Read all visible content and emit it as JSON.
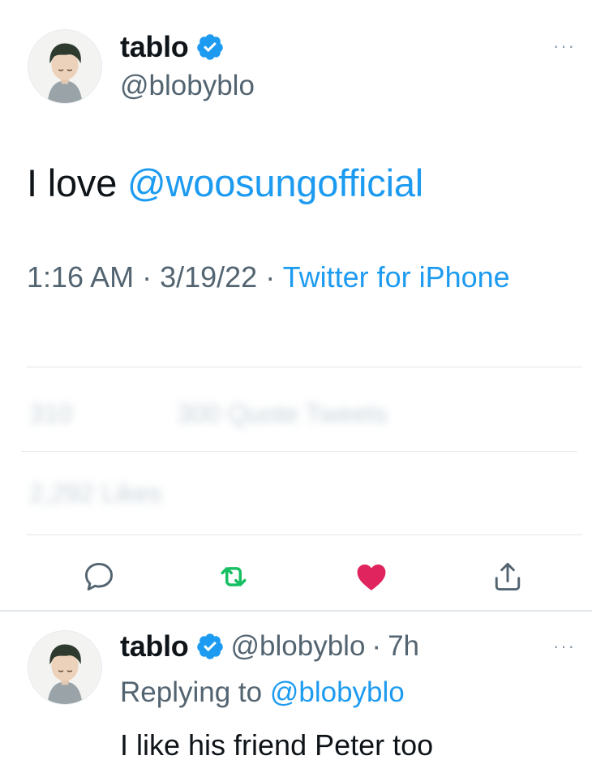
{
  "tweet": {
    "author_name": "tablo",
    "author_handle": "@blobyblo",
    "more_label": "···",
    "text_prefix": "I love ",
    "mention": "@woosungofficial",
    "time": "1:16 AM",
    "dot1": " · ",
    "date": "3/19/22",
    "dot2": " · ",
    "source": "Twitter for iPhone",
    "stats_row1": {
      "retweets": "310",
      "quotes": "300 Quote Tweets"
    },
    "stats_row2": {
      "likes": "2,292 Likes"
    }
  },
  "actions": {
    "reply_icon": "reply-icon",
    "retweet_icon": "retweet-icon",
    "like_icon": "heart-icon",
    "share_icon": "share-icon",
    "retweet_color": "#17bf63",
    "like_color": "#e0245e"
  },
  "reply": {
    "author_name": "tablo",
    "author_handle": "@blobyblo",
    "dot": "·",
    "time_ago": "7h",
    "more_label": "···",
    "replying_to_label": "Replying to",
    "replying_to_handle": "@blobyblo",
    "text": "I like his friend Peter too"
  },
  "colors": {
    "accent": "#1d9bf0",
    "text": "#0f1419",
    "muted": "#536471"
  }
}
